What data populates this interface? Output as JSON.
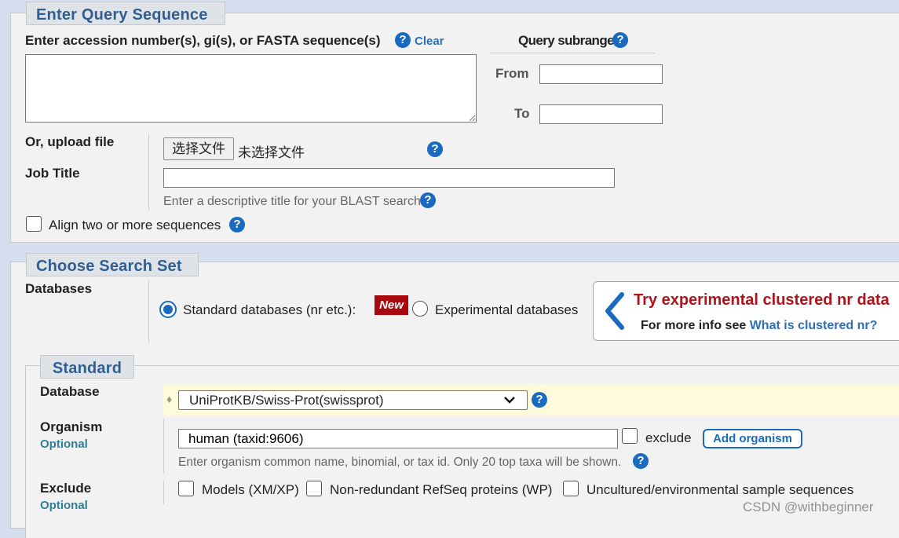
{
  "query": {
    "legend": "Enter Query Sequence",
    "accession_label": "Enter accession number(s), gi(s), or FASTA sequence(s)",
    "clear_link": "Clear",
    "sequence_value": "",
    "subrange_title": "Query subrange",
    "from_label": "From",
    "from_value": "",
    "to_label": "To",
    "to_value": "",
    "upload_label": "Or, upload file",
    "choose_file_button": "选择文件",
    "no_file_text": "未选择文件",
    "job_title_label": "Job Title",
    "job_title_value": "",
    "job_title_hint": "Enter a descriptive title for your BLAST search",
    "align_label": "Align two or more sequences"
  },
  "search_set": {
    "legend": "Choose Search Set",
    "databases_label": "Databases",
    "standard_radio": "Standard databases (nr etc.):",
    "new_badge": "New",
    "experimental_radio": "Experimental databases",
    "promo_title": "Try experimental clustered nr data",
    "promo_text": "For more info see",
    "promo_link": "What is clustered nr?"
  },
  "standard": {
    "legend": "Standard",
    "database_label": "Database",
    "database_selected": "UniProtKB/Swiss-Prot(swissprot)",
    "organism_label": "Organism",
    "optional": "Optional",
    "organism_value": "human (taxid:9606)",
    "exclude_checkbox": "exclude",
    "add_organism_button": "Add organism",
    "organism_hint": "Enter organism common name, binomial, or tax id. Only 20 top taxa will be shown.",
    "exclude_label": "Exclude",
    "exclude_optional": "Optional",
    "exclude_options": [
      "Models (XM/XP)",
      "Non-redundant RefSeq proteins (WP)",
      "Uncultured/environmental sample sequences"
    ]
  },
  "watermark": "CSDN @withbeginner",
  "colors": {
    "accent": "#1a6bbf",
    "legend_text": "#2f5f91",
    "promo_red": "#b0141a",
    "database_row_bg": "#fdfbdc"
  }
}
